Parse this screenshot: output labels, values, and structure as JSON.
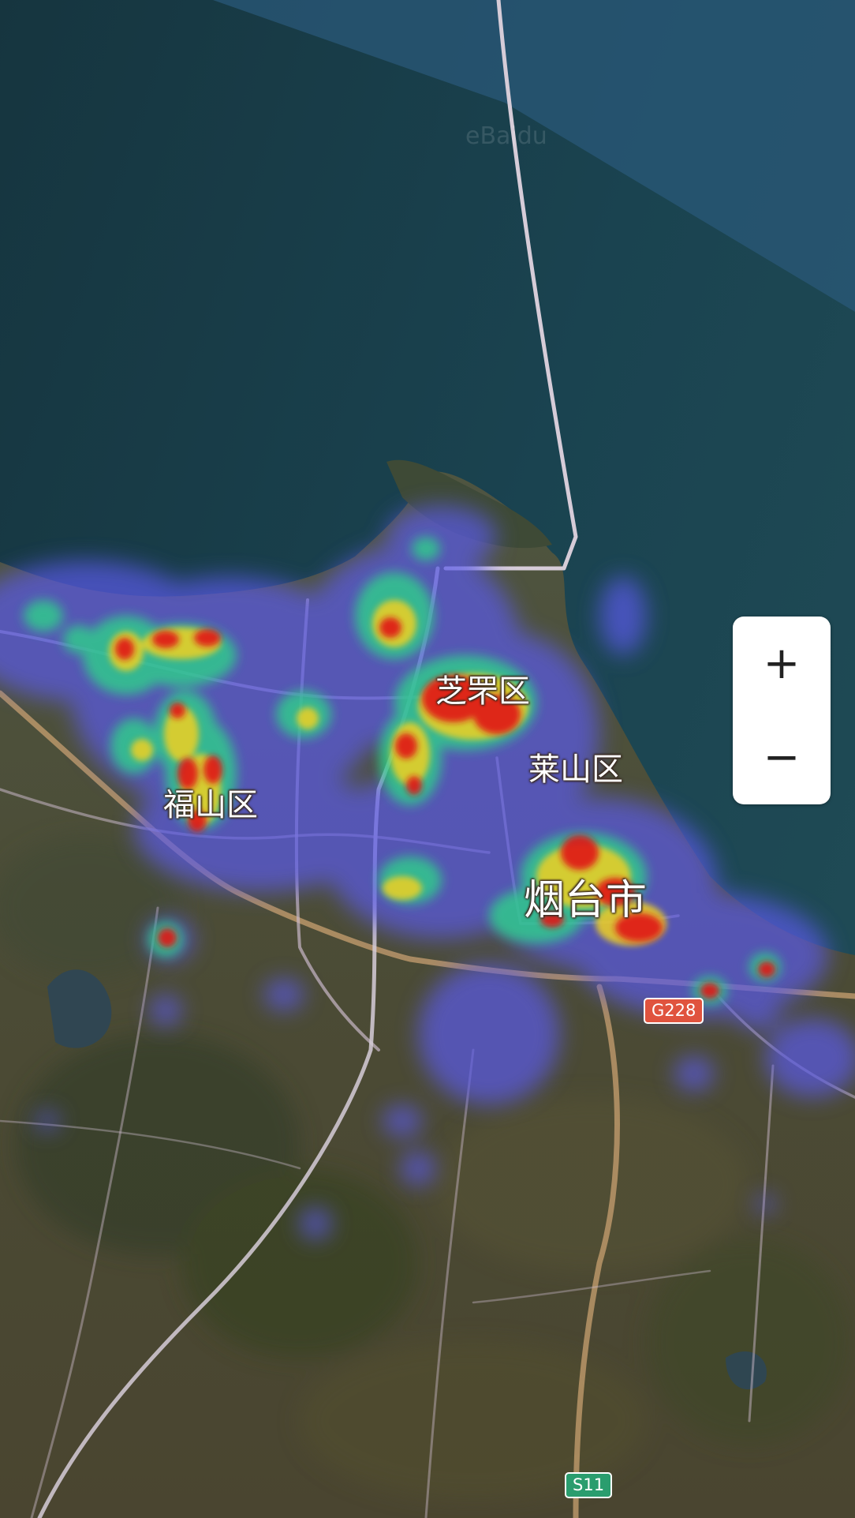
{
  "map": {
    "type": "satellite-heatmap",
    "watermark": "eBaidu",
    "colors": {
      "sea_deep": "#16363f",
      "sea_light": "#2a5878",
      "land": "#4a4a35",
      "road_major": "#c9b8c8",
      "road_highway": "#c8a070",
      "heat_low": "#5a5ae8",
      "heat_mid": "#2fd08a",
      "heat_high": "#f0d020",
      "heat_peak": "#e01818"
    }
  },
  "labels": {
    "zhifu": "芝罘区",
    "laishan": "莱山区",
    "fushan": "福山区",
    "yantai": "烟台市"
  },
  "roads": {
    "g228": "G228",
    "s11": "S11"
  },
  "zoom": {
    "in_icon": "plus-icon",
    "in_label": "+",
    "out_icon": "minus-icon",
    "out_label": "−"
  }
}
